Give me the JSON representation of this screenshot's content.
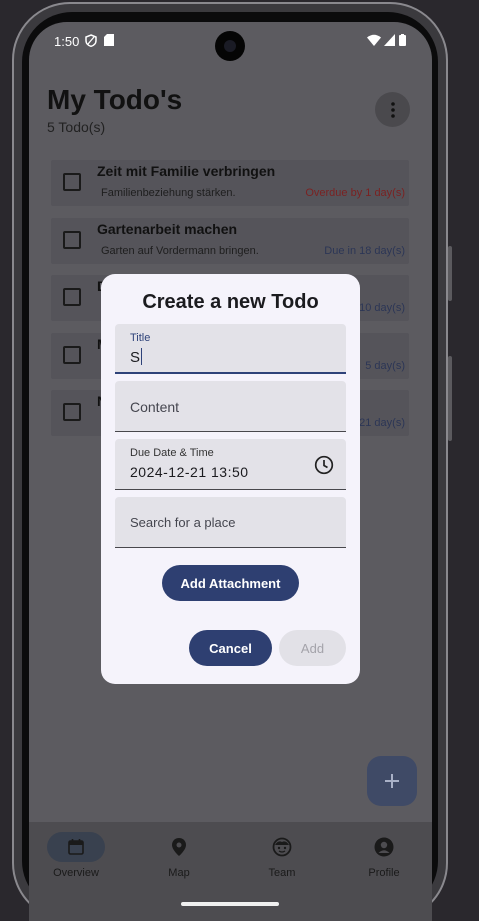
{
  "status": {
    "time": "1:50"
  },
  "header": {
    "title": "My Todo's",
    "subtitle": "5 Todo(s)"
  },
  "todos": [
    {
      "title": "Zeit mit Familie verbringen",
      "content": "Familienbeziehung stärken.",
      "due": "Overdue by 1 day(s)"
    },
    {
      "title": "Gartenarbeit machen",
      "content": "Garten auf Vordermann bringen.",
      "due": "Due in 18 day(s)"
    },
    {
      "title": "D",
      "content": "",
      "due": "10 day(s)"
    },
    {
      "title": "M",
      "content": "",
      "due": "5 day(s)"
    },
    {
      "title": "N",
      "content": "",
      "due": "21 day(s)"
    }
  ],
  "dialog": {
    "title": "Create a new Todo",
    "fields": {
      "title": {
        "label": "Title",
        "value": "S"
      },
      "content": {
        "placeholder": "Content"
      },
      "due": {
        "label": "Due Date & Time",
        "value": "2024-12-21 13:50"
      },
      "place": {
        "placeholder": "Search for a place"
      }
    },
    "attachment_label": "Add Attachment",
    "cancel_label": "Cancel",
    "add_label": "Add"
  },
  "fab": {
    "icon": "plus-icon"
  },
  "nav": [
    {
      "label": "Overview",
      "icon": "calendar-icon",
      "active": true
    },
    {
      "label": "Map",
      "icon": "map-pin-icon",
      "active": false
    },
    {
      "label": "Team",
      "icon": "team-face-icon",
      "active": false
    },
    {
      "label": "Profile",
      "icon": "account-circle-icon",
      "active": false
    }
  ],
  "colors": {
    "primary": "#2e3f71",
    "overdue": "#7a2222",
    "due": "#2c3656",
    "dialog_bg": "#f5f3fb"
  }
}
